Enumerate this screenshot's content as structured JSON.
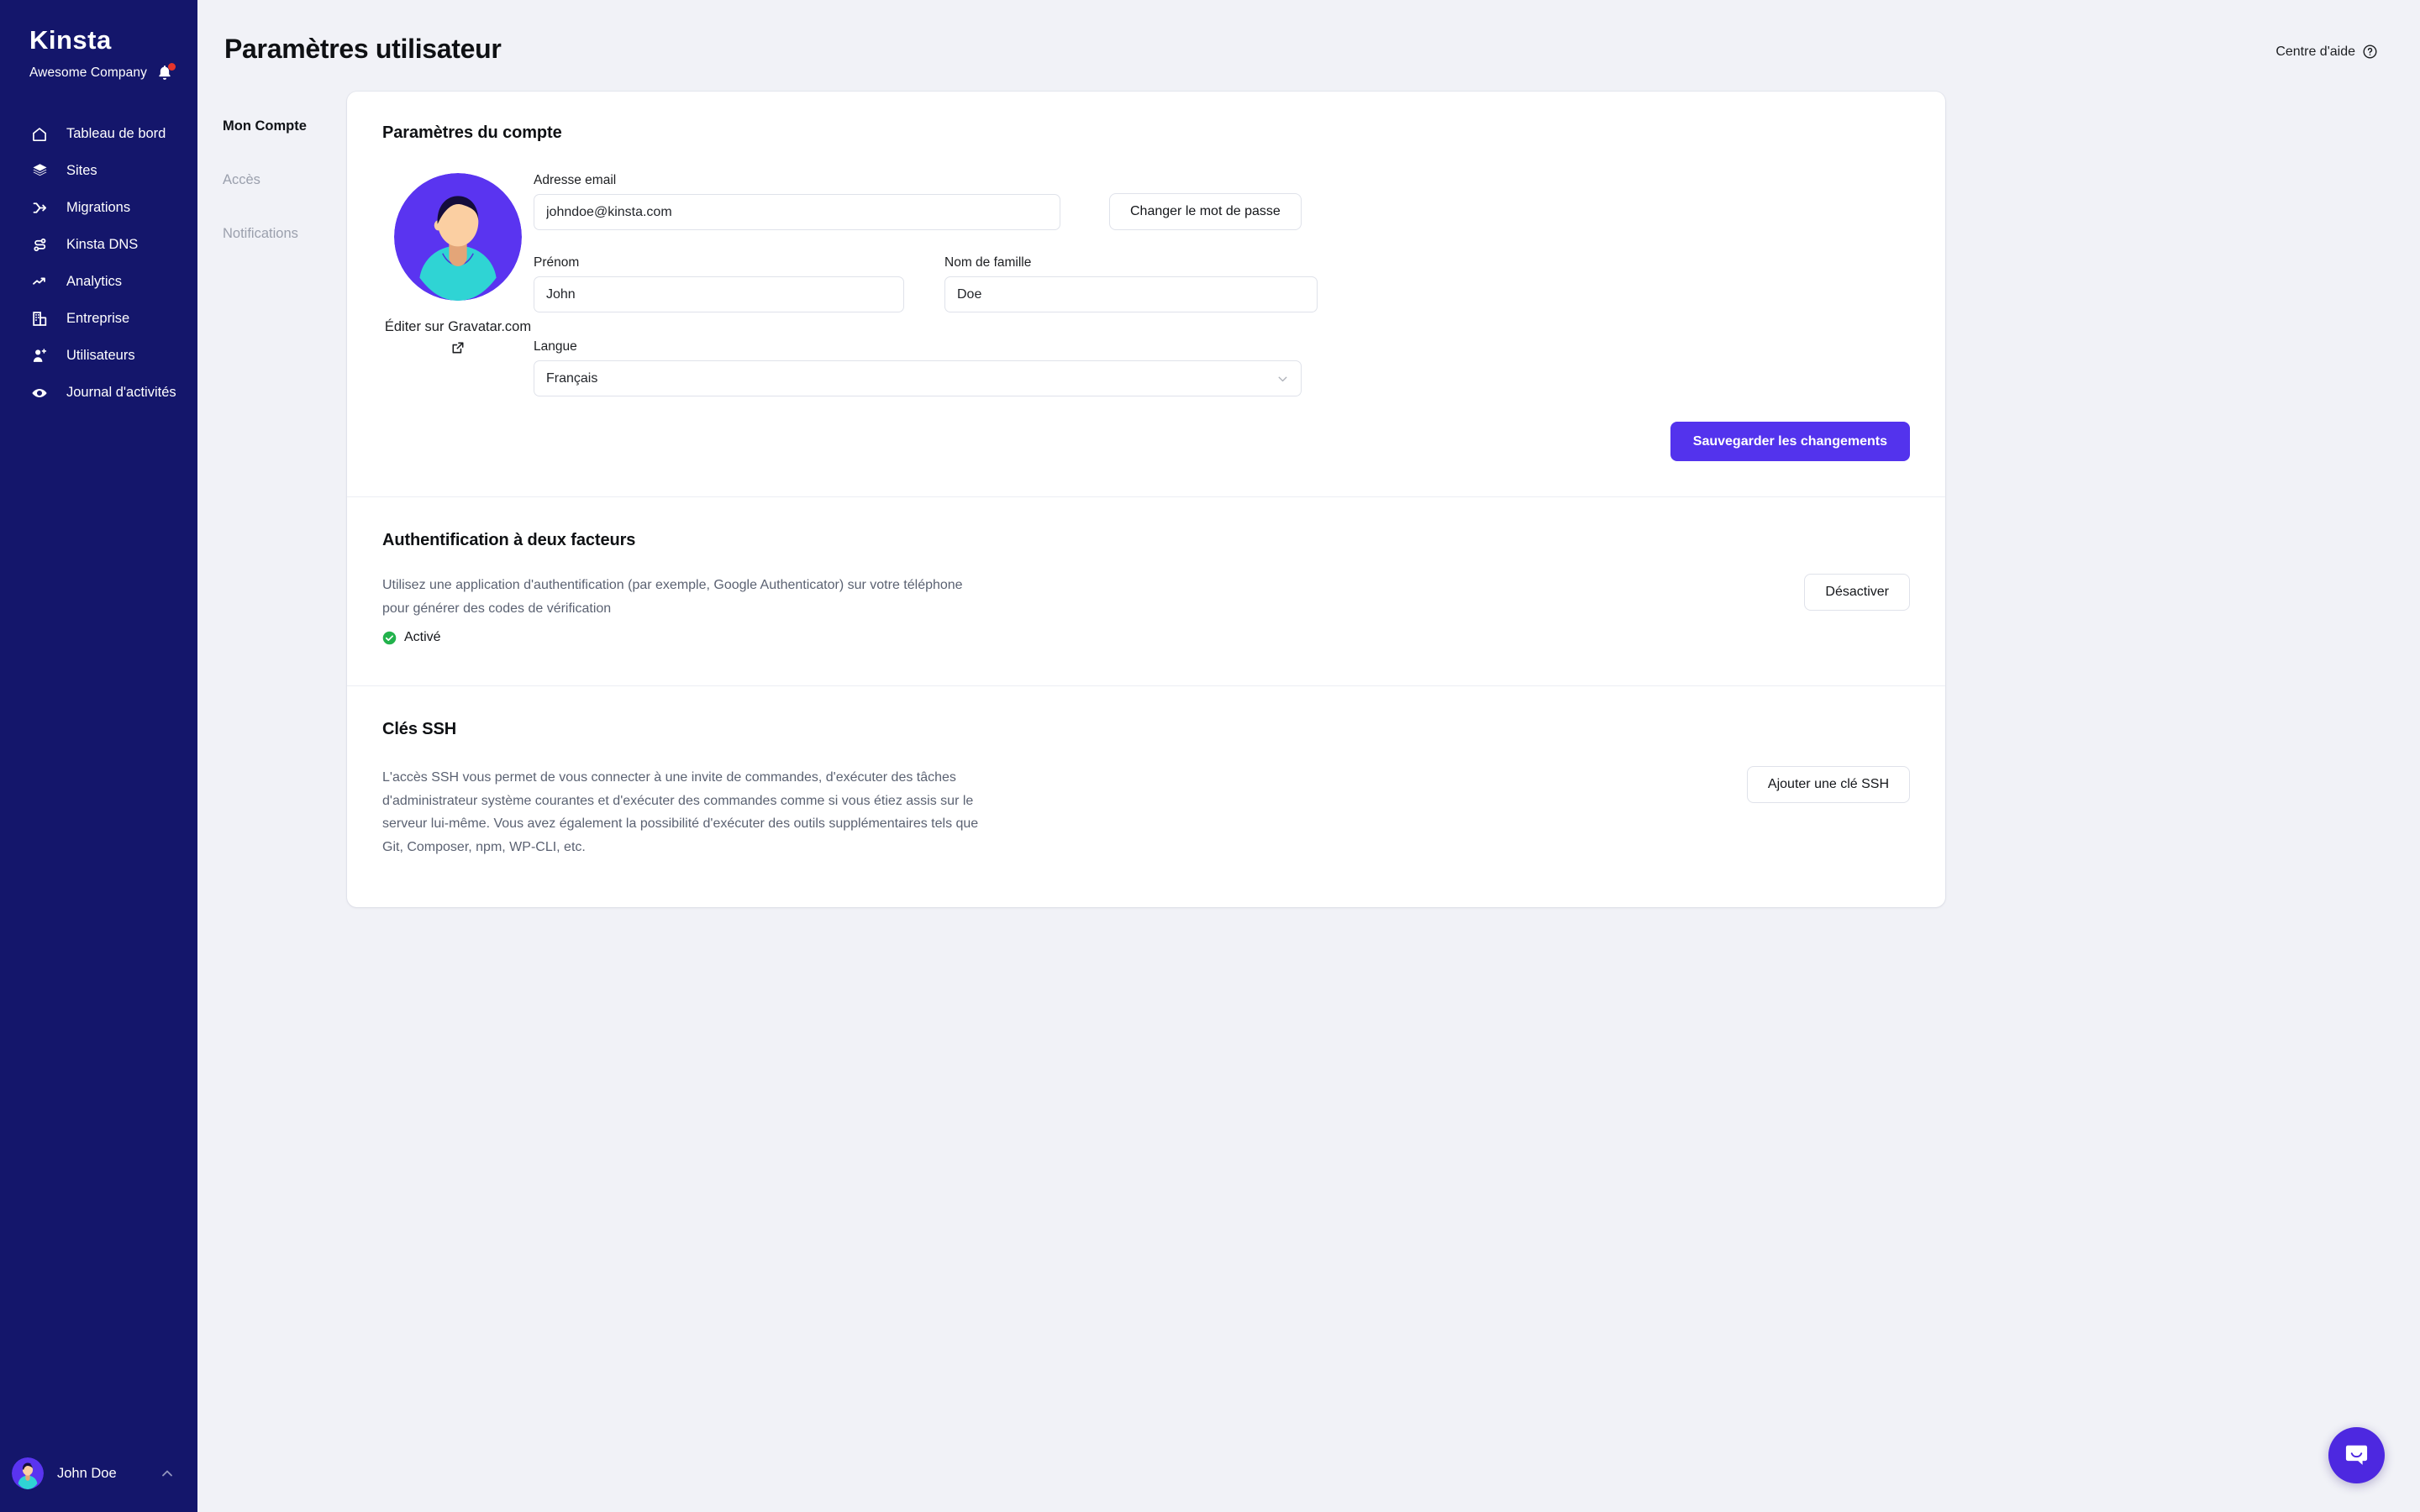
{
  "sidebar": {
    "logo": "Kinsta",
    "company": "Awesome Company",
    "notification_icon": "bell-icon",
    "nav": [
      {
        "label": "Tableau de bord",
        "icon": "home-icon"
      },
      {
        "label": "Sites",
        "icon": "layers-icon"
      },
      {
        "label": "Migrations",
        "icon": "merge-icon"
      },
      {
        "label": "Kinsta DNS",
        "icon": "dns-nodes-icon"
      },
      {
        "label": "Analytics",
        "icon": "trend-up-icon"
      },
      {
        "label": "Entreprise",
        "icon": "building-icon"
      },
      {
        "label": "Utilisateurs",
        "icon": "user-plus-icon"
      },
      {
        "label": "Journal d'activités",
        "icon": "eye-icon"
      }
    ],
    "footer": {
      "name": "John Doe",
      "chevron": "chevron-up-icon"
    }
  },
  "header": {
    "title": "Paramètres utilisateur",
    "help": {
      "label": "Centre d'aide",
      "icon": "question-circle-icon"
    }
  },
  "subnav": [
    {
      "label": "Mon Compte",
      "active": true
    },
    {
      "label": "Accès",
      "active": false
    },
    {
      "label": "Notifications",
      "active": false
    }
  ],
  "account": {
    "title": "Paramètres du compte",
    "gravatar_link": "Éditer sur Gravatar.com",
    "gravatar_icon": "external-link-icon",
    "email": {
      "label": "Adresse email",
      "value": "johndoe@kinsta.com"
    },
    "change_password_button": "Changer le mot de passe",
    "first_name": {
      "label": "Prénom",
      "value": "John"
    },
    "last_name": {
      "label": "Nom de famille",
      "value": "Doe"
    },
    "language": {
      "label": "Langue",
      "value": "Français",
      "caret": "chevron-down-icon"
    },
    "save_button": "Sauvegarder les changements"
  },
  "two_factor": {
    "title": "Authentification à deux facteurs",
    "description": "Utilisez une application d'authentification (par exemple, Google Authenticator) sur votre téléphone pour générer des codes de vérification",
    "status": "Activé",
    "status_icon": "check-circle-icon",
    "disable_button": "Désactiver"
  },
  "ssh": {
    "title": "Clés SSH",
    "description": "L'accès SSH vous permet de vous connecter à une invite de commandes, d'exécuter des tâches d'administrateur système courantes et d'exécuter des commandes comme si vous étiez assis sur le serveur lui-même. Vous avez également la possibilité d'exécuter des outils supplémentaires tels que Git, Composer, npm, WP-CLI, etc.",
    "add_button": "Ajouter une clé SSH",
    "annotation": "arrow-pointing-to-add-ssh-key-button"
  },
  "chat": {
    "icon": "chat-bubble-icon"
  },
  "colors": {
    "sidebar_bg": "#14166b",
    "accent": "#5333ed",
    "annotation_arrow": "#5433ed",
    "page_bg": "#f1f2f7",
    "status_green": "#22b24c",
    "notification_red": "#e5342b",
    "muted_text": "#9ba0ad",
    "body_text": "#5b6272"
  }
}
